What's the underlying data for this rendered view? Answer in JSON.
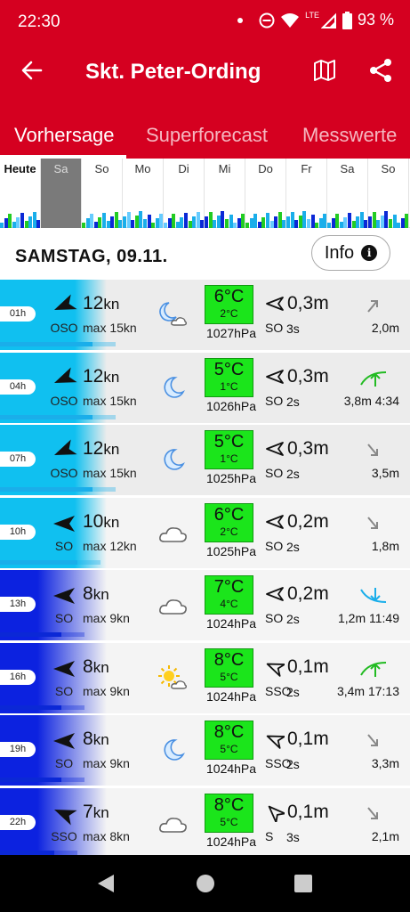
{
  "status": {
    "time": "22:30",
    "lte": "LTE",
    "battery": "93 %"
  },
  "appbar": {
    "title": "Skt. Peter-Ording"
  },
  "tabs": [
    {
      "label": "Vorhersage",
      "active": true
    },
    {
      "label": "Superforecast",
      "active": false
    },
    {
      "label": "Messwerte",
      "active": false
    }
  ],
  "days": [
    "Heute",
    "Sa",
    "So",
    "Mo",
    "Di",
    "Mi",
    "Do",
    "Fr",
    "Sa",
    "So"
  ],
  "selected_day": "Sa",
  "date_header": "SAMSTAG, 09.11.",
  "info_label": "Info",
  "info_icon": "i",
  "units": {
    "kn": "kn",
    "max": "max",
    "wave": "m"
  },
  "rows": [
    {
      "hour": "01h",
      "wind": "12",
      "wind_dir": "OSO",
      "max": "max 15kn",
      "weather": "moon-cloud-icon",
      "temp": "6°C",
      "temp_min": "2°C",
      "pressure": "1027hPa",
      "wave": "0,3",
      "wave_dir": "SO",
      "wave_period": "3s",
      "tide_icon": "tide-arrow-up-right-icon",
      "tide_text": "2,0m"
    },
    {
      "hour": "04h",
      "wind": "12",
      "wind_dir": "OSO",
      "max": "max 15kn",
      "weather": "moon-icon",
      "temp": "5°C",
      "temp_min": "1°C",
      "pressure": "1026hPa",
      "wave": "0,3",
      "wave_dir": "SO",
      "wave_period": "2s",
      "tide_icon": "high-tide-icon",
      "tide_text": "3,8m 4:34"
    },
    {
      "hour": "07h",
      "wind": "12",
      "wind_dir": "OSO",
      "max": "max 15kn",
      "weather": "moon-icon",
      "temp": "5°C",
      "temp_min": "1°C",
      "pressure": "1025hPa",
      "wave": "0,3",
      "wave_dir": "SO",
      "wave_period": "2s",
      "tide_icon": "tide-arrow-down-right-icon",
      "tide_text": "3,5m"
    },
    {
      "hour": "10h",
      "wind": "10",
      "wind_dir": "SO",
      "max": "max 12kn",
      "weather": "cloud-icon",
      "temp": "6°C",
      "temp_min": "2°C",
      "pressure": "1025hPa",
      "wave": "0,2",
      "wave_dir": "SO",
      "wave_period": "2s",
      "tide_icon": "tide-arrow-down-right-icon",
      "tide_text": "1,8m"
    },
    {
      "hour": "13h",
      "wind": "8",
      "wind_dir": "SO",
      "max": "max 9kn",
      "weather": "cloud-icon",
      "temp": "7°C",
      "temp_min": "4°C",
      "pressure": "1024hPa",
      "wave": "0,2",
      "wave_dir": "SO",
      "wave_period": "2s",
      "tide_icon": "low-tide-icon",
      "tide_text": "1,2m 11:49"
    },
    {
      "hour": "16h",
      "wind": "8",
      "wind_dir": "SO",
      "max": "max 9kn",
      "weather": "sun-cloud-icon",
      "temp": "8°C",
      "temp_min": "5°C",
      "pressure": "1024hPa",
      "wave": "0,1",
      "wave_dir": "SSO",
      "wave_period": "2s",
      "tide_icon": "high-tide-icon",
      "tide_text": "3,4m 17:13"
    },
    {
      "hour": "19h",
      "wind": "8",
      "wind_dir": "SO",
      "max": "max 9kn",
      "weather": "moon-icon",
      "temp": "8°C",
      "temp_min": "5°C",
      "pressure": "1024hPa",
      "wave": "0,1",
      "wave_dir": "SSO",
      "wave_period": "2s",
      "tide_icon": "tide-arrow-down-right-icon",
      "tide_text": "3,3m"
    },
    {
      "hour": "22h",
      "wind": "7",
      "wind_dir": "SSO",
      "max": "max 8kn",
      "weather": "cloud-icon",
      "temp": "8°C",
      "temp_min": "5°C",
      "pressure": "1024hPa",
      "wave": "0,1",
      "wave_dir": "S",
      "wave_period": "3s",
      "tide_icon": "tide-arrow-down-right-icon",
      "tide_text": "2,1m"
    }
  ],
  "colors": {
    "brand": "#d50020",
    "temp_green": "#1be51b",
    "wind_light": "#1aaeea",
    "wind_dark": "#0b28d6",
    "tide_green": "#22bb22",
    "tide_cyan": "#1aaeea"
  }
}
